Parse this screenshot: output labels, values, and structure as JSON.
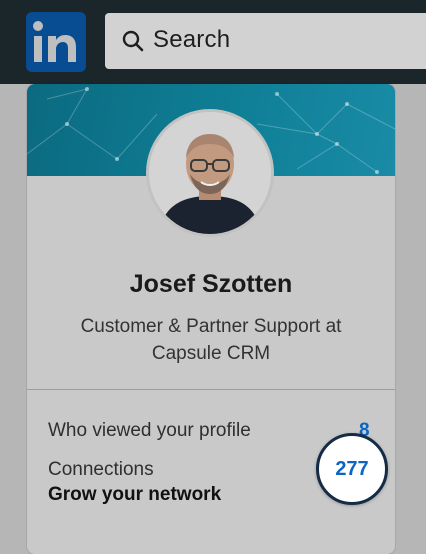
{
  "header": {
    "logo_text": "in",
    "search": {
      "placeholder": "Search",
      "icon": "search-icon"
    }
  },
  "profile": {
    "name": "Josef Szotten",
    "headline": "Customer & Partner Support at Capsule CRM"
  },
  "stats": {
    "views_label": "Who viewed your profile",
    "views_count": "8",
    "connections_label": "Connections",
    "connections_cta": "Grow your network",
    "connections_count": "277"
  },
  "colors": {
    "brand": "#0a66c2",
    "topbar": "#1a2629",
    "banner": "#0f7f96"
  }
}
